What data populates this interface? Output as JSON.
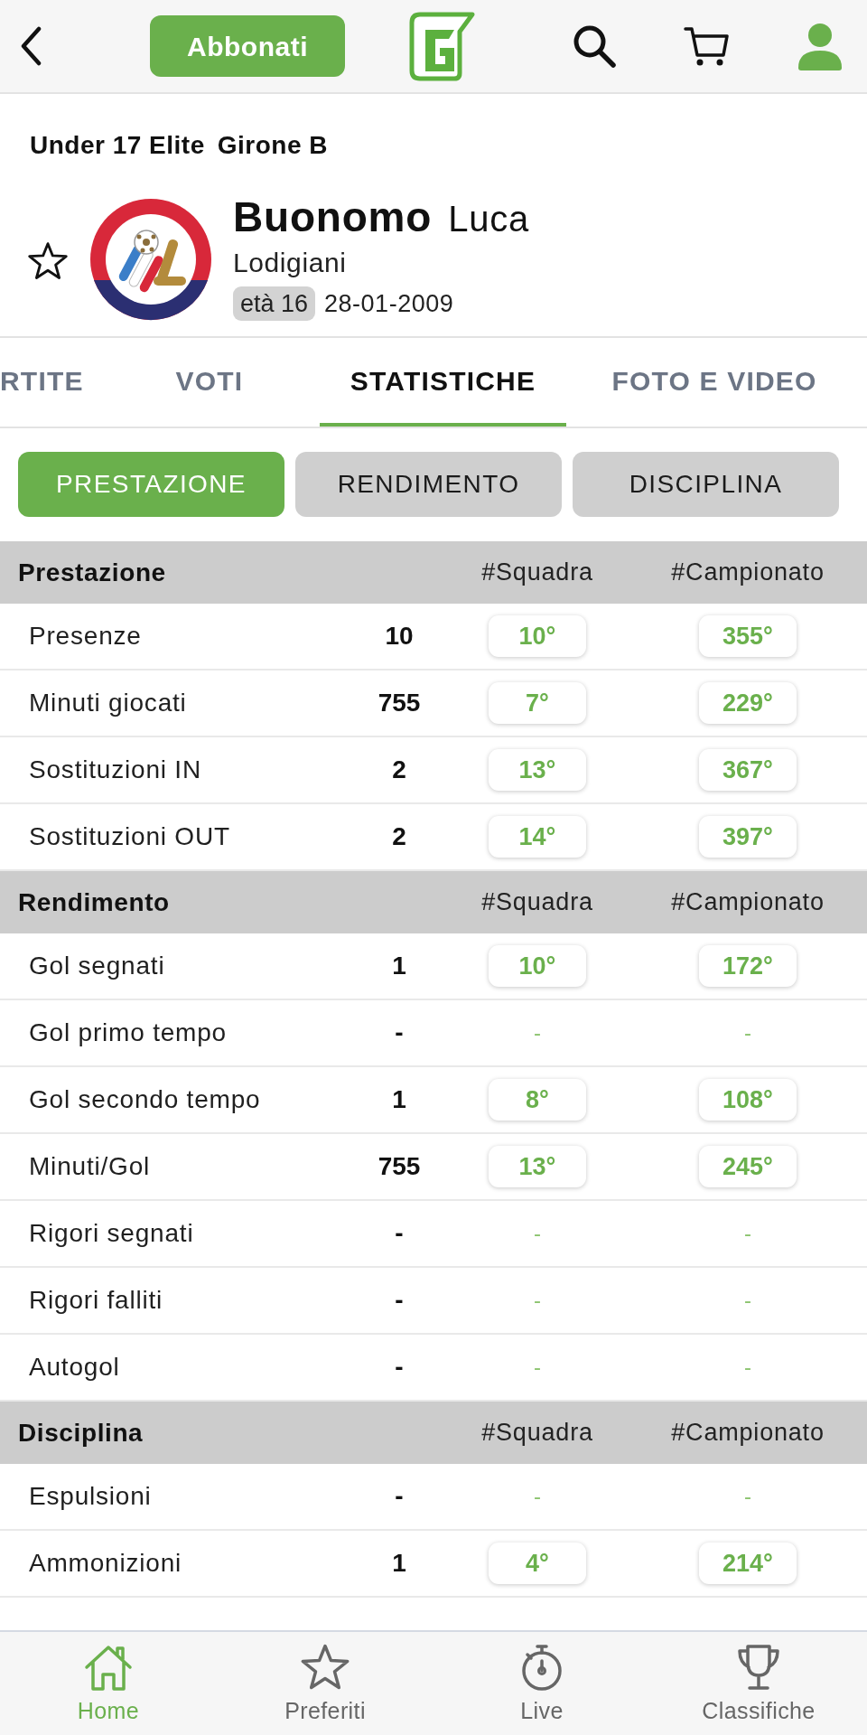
{
  "top_bar": {
    "subscribe_button": "Abbonati"
  },
  "header": {
    "competition": "Under 17 Elite",
    "group": "Girone B",
    "favorite": false,
    "surname": "Buonomo",
    "first_name": "Luca",
    "team": "Lodigiani",
    "age_badge": "età 16",
    "birth_date": "28-01-2009"
  },
  "tabs": [
    {
      "label": "RTITE",
      "selected": false
    },
    {
      "label": "VOTI",
      "selected": false
    },
    {
      "label": "STATISTICHE",
      "selected": true
    },
    {
      "label": "FOTO E VIDEO",
      "selected": false
    }
  ],
  "filters": [
    {
      "label": "PRESTAZIONE",
      "selected": true
    },
    {
      "label": "RENDIMENTO",
      "selected": false
    },
    {
      "label": "DISCIPLINA",
      "selected": false
    }
  ],
  "sections": [
    {
      "title": "Prestazione",
      "columns": [
        "#Squadra",
        "#Campionato"
      ],
      "rows": [
        {
          "label": "Presenze",
          "value": "10",
          "ranked": true,
          "team_rank": "10°",
          "league_rank": "355°"
        },
        {
          "label": "Minuti giocati",
          "value": "755",
          "ranked": true,
          "team_rank": "7°",
          "league_rank": "229°"
        },
        {
          "label": "Sostituzioni IN",
          "value": "2",
          "ranked": true,
          "team_rank": "13°",
          "league_rank": "367°"
        },
        {
          "label": "Sostituzioni OUT",
          "value": "2",
          "ranked": true,
          "team_rank": "14°",
          "league_rank": "397°"
        }
      ]
    },
    {
      "title": "Rendimento",
      "columns": [
        "#Squadra",
        "#Campionato"
      ],
      "rows": [
        {
          "label": "Gol segnati",
          "value": "1",
          "ranked": true,
          "team_rank": "10°",
          "league_rank": "172°"
        },
        {
          "label": "Gol primo tempo",
          "value": "-",
          "ranked": false,
          "team_rank": "-",
          "league_rank": "-"
        },
        {
          "label": "Gol secondo tempo",
          "value": "1",
          "ranked": true,
          "team_rank": "8°",
          "league_rank": "108°"
        },
        {
          "label": "Minuti/Gol",
          "value": "755",
          "ranked": true,
          "team_rank": "13°",
          "league_rank": "245°"
        },
        {
          "label": "Rigori segnati",
          "value": "-",
          "ranked": false,
          "team_rank": "-",
          "league_rank": "-"
        },
        {
          "label": "Rigori falliti",
          "value": "-",
          "ranked": false,
          "team_rank": "-",
          "league_rank": "-"
        },
        {
          "label": "Autogol",
          "value": "-",
          "ranked": false,
          "team_rank": "-",
          "league_rank": "-"
        }
      ]
    },
    {
      "title": "Disciplina",
      "columns": [
        "#Squadra",
        "#Campionato"
      ],
      "rows": [
        {
          "label": "Espulsioni",
          "value": "-",
          "ranked": false,
          "team_rank": "-",
          "league_rank": "-"
        },
        {
          "label": "Ammonizioni",
          "value": "1",
          "ranked": true,
          "team_rank": "4°",
          "league_rank": "214°"
        }
      ]
    }
  ],
  "bottom_nav": [
    {
      "label": "Home",
      "selected": true
    },
    {
      "label": "Preferiti",
      "selected": false
    },
    {
      "label": "Live",
      "selected": false
    },
    {
      "label": "Classifiche",
      "selected": false
    }
  ]
}
